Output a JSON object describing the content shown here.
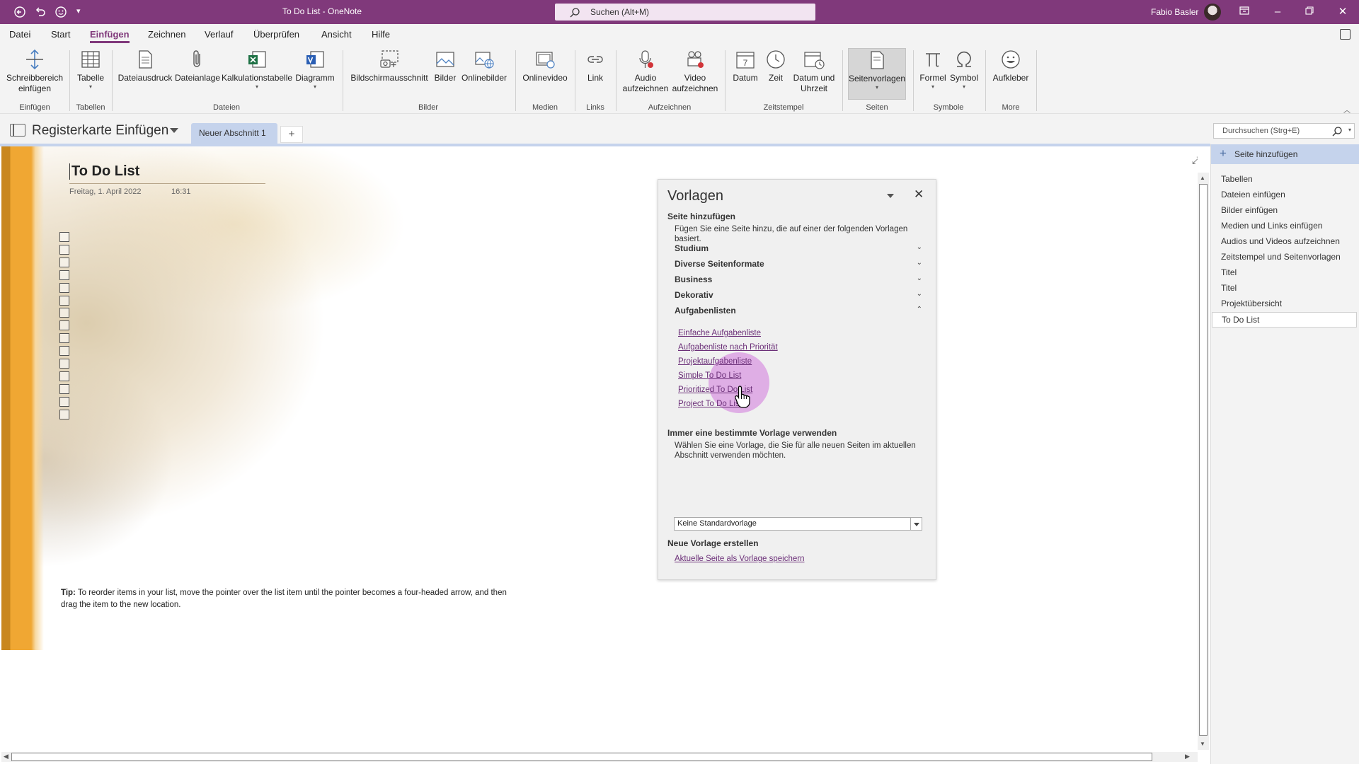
{
  "titlebar": {
    "doc_title": "To Do List  -  OneNote",
    "search_placeholder": "Suchen (Alt+M)",
    "user_name": "Fabio Basler"
  },
  "menu": {
    "items": [
      "Datei",
      "Start",
      "Einfügen",
      "Zeichnen",
      "Verlauf",
      "Überprüfen",
      "Ansicht",
      "Hilfe"
    ],
    "active": "Einfügen"
  },
  "ribbon": {
    "buttons": {
      "schreibbereich": "Schreibbereich\neinfügen",
      "tabelle": "Tabelle",
      "dateiausdruck": "Dateiausdruck",
      "dateianlage": "Dateianlage",
      "kalkulationstabelle": "Kalkulationstabelle",
      "diagramm": "Diagramm",
      "bildschirmausschnitt": "Bildschirmausschnitt",
      "bilder": "Bilder",
      "onlinebilder": "Onlinebilder",
      "onlinevideo": "Onlinevideo",
      "link": "Link",
      "audio": "Audio\naufzeichnen",
      "video": "Video\naufzeichnen",
      "datum": "Datum",
      "zeit": "Zeit",
      "datum_uhrzeit": "Datum und\nUhrzeit",
      "seitenvorlagen": "Seitenvorlagen",
      "formel": "Formel",
      "symbol": "Symbol",
      "aufkleber": "Aufkleber"
    },
    "groups": {
      "einfuegen": "Einfügen",
      "tabellen": "Tabellen",
      "dateien": "Dateien",
      "bilder": "Bilder",
      "medien": "Medien",
      "links": "Links",
      "aufzeichnen": "Aufzeichnen",
      "zeitstempel": "Zeitstempel",
      "seiten": "Seiten",
      "symbole": "Symbole",
      "more": "More"
    }
  },
  "notebook": {
    "name": "Registerkarte Einfügen",
    "section_tab": "Neuer Abschnitt 1",
    "add_section": "+",
    "page_search_placeholder": "Durchsuchen (Strg+E)"
  },
  "page": {
    "title": "To Do List",
    "date": "Freitag, 1. April 2022",
    "time": "16:31",
    "checkbox_count": 15,
    "tip_label": "Tip:",
    "tip_text": "To reorder items in your list, move the pointer over the list item until the pointer becomes a four-headed arrow, and then drag the item to the new location."
  },
  "templates_pane": {
    "title": "Vorlagen",
    "add_page_heading": "Seite hinzufügen",
    "add_page_desc": "Fügen Sie eine Seite hinzu, die auf einer der folgenden Vorlagen basiert.",
    "categories": [
      {
        "label": "Studium",
        "expanded": false
      },
      {
        "label": "Diverse Seitenformate",
        "expanded": false
      },
      {
        "label": "Business",
        "expanded": false
      },
      {
        "label": "Dekorativ",
        "expanded": false
      },
      {
        "label": "Aufgabenlisten",
        "expanded": true
      }
    ],
    "templates": [
      "Einfache Aufgabenliste",
      "Aufgabenliste nach Priorität",
      "Projektaufgabenliste",
      "Simple To Do List",
      "Prioritized To Do List",
      "Project To Do List"
    ],
    "default_heading": "Immer eine bestimmte Vorlage verwenden",
    "default_desc": "Wählen Sie eine Vorlage, die Sie für alle neuen Seiten im aktuellen Abschnitt verwenden möchten.",
    "default_value": "Keine Standardvorlage",
    "create_heading": "Neue Vorlage erstellen",
    "create_link": "Aktuelle Seite als Vorlage speichern"
  },
  "pages_pane": {
    "add_label": "Seite hinzufügen",
    "items": [
      "Tabellen",
      "Dateien einfügen",
      "Bilder einfügen",
      "Medien und Links einfügen",
      "Audios und Videos aufzeichnen",
      "Zeitstempel und Seitenvorlagen",
      "Titel",
      "Titel",
      "Projektübersicht",
      "To Do List"
    ],
    "selected": "To Do List"
  },
  "colors": {
    "accent": "#80397b",
    "tab_blue": "#c5d3ec",
    "link": "#6b2f78"
  }
}
